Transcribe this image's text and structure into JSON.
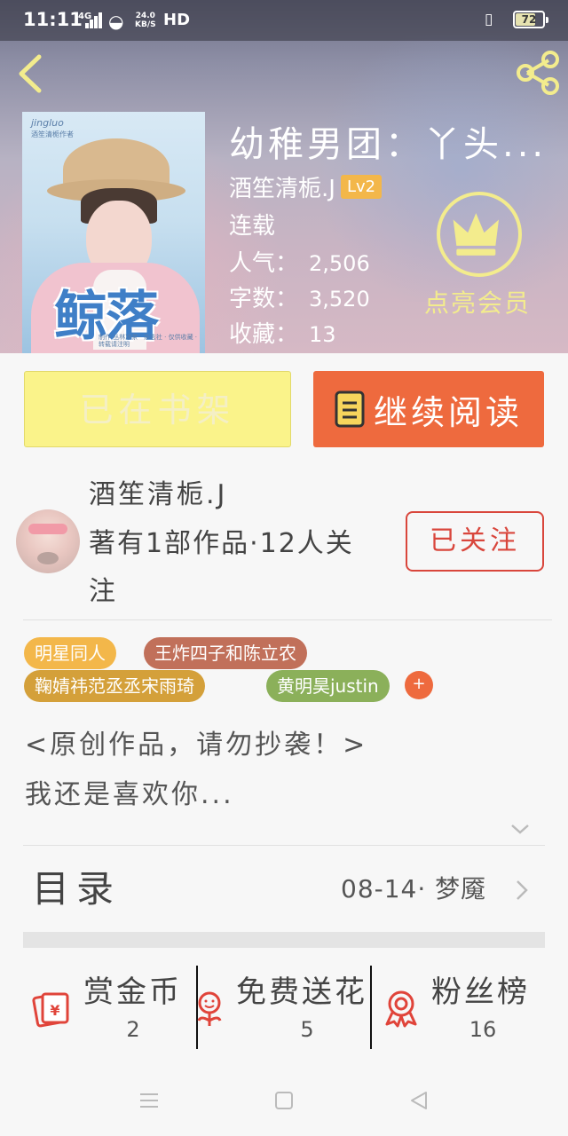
{
  "status_bar": {
    "time": "11:11",
    "network": "4G",
    "speed_value": "24.0",
    "speed_unit": "KB/S",
    "hd": "HD",
    "battery": "72"
  },
  "book": {
    "title": "幼稚男团：丫头...",
    "author": "酒笙清栀.J",
    "level": "Lv2",
    "status": "连载",
    "popularity_label": "人气：",
    "popularity": "2,506",
    "words_label": "字数：",
    "words": "3,520",
    "favorites_label": "收藏：",
    "favorites": "13",
    "cover": {
      "title": "鲸落",
      "top_text": "jingluo",
      "sub_text": "酒笙清栀作者",
      "small_text": "制作 丛林凉茶 · 杂志社 · 仅供收藏 · 转载请注明"
    },
    "vip_label": "点亮会员"
  },
  "actions": {
    "shelf": "已在书架",
    "continue_read": "继续阅读"
  },
  "author_card": {
    "name": "酒笙清栀.J",
    "description": "著有1部作品·12人关注",
    "follow": "已关注"
  },
  "tags": [
    {
      "label": "明星同人",
      "color": "#f3b74a"
    },
    {
      "label": "王炸四子和陈立农",
      "color": "#c1705a"
    },
    {
      "label": "鞠婧祎范丞丞宋雨琦",
      "color": "#d4a03a"
    },
    {
      "label": "黄明昊justin",
      "color": "#8bb05a"
    }
  ],
  "tag_more": "+",
  "description": {
    "line1": "<原创作品，请勿抄袭！>",
    "line2": "我还是喜欢你..."
  },
  "catalog": {
    "label": "目录",
    "latest": "08-14· 梦魇"
  },
  "bottom_actions": [
    {
      "label": "赏金币",
      "count": "2",
      "icon": "gold-coin-envelope-icon"
    },
    {
      "label": "免费送花",
      "count": "5",
      "icon": "flower-icon"
    },
    {
      "label": "粉丝榜",
      "count": "16",
      "icon": "ribbon-medal-icon"
    }
  ],
  "colors": {
    "accent_orange": "#ee6a3e",
    "shelf_yellow": "#faf38a",
    "follow_red": "#d9463c",
    "icon_red": "#e0443a"
  }
}
